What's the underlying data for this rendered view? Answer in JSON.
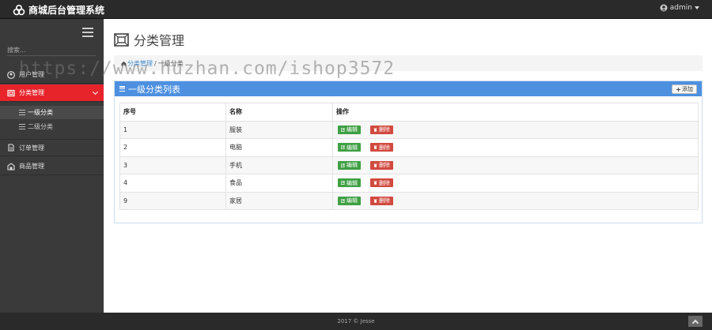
{
  "app": {
    "title": "商城后台管理系统",
    "user": "admin"
  },
  "sidebar": {
    "search_placeholder": "搜索...",
    "items": [
      {
        "label": "用户管理",
        "icon": "user-icon"
      },
      {
        "label": "分类管理",
        "icon": "category-icon",
        "active": true,
        "children": [
          {
            "label": "一级分类",
            "current": true
          },
          {
            "label": "二级分类"
          }
        ]
      },
      {
        "label": "订单管理",
        "icon": "order-icon"
      },
      {
        "label": "商品管理",
        "icon": "product-icon"
      }
    ]
  },
  "main": {
    "page_title": "分类管理",
    "breadcrumb": {
      "parent": "分类管理",
      "separator": "/",
      "current": "一级分类"
    },
    "panel": {
      "title": "一级分类列表",
      "add_label": "添加",
      "columns": [
        "序号",
        "名称",
        "操作"
      ],
      "edit_label": "编辑",
      "delete_label": "删除",
      "rows": [
        {
          "id": "1",
          "name": "服装"
        },
        {
          "id": "2",
          "name": "电脑"
        },
        {
          "id": "3",
          "name": "手机"
        },
        {
          "id": "4",
          "name": "食品"
        },
        {
          "id": "9",
          "name": "家居"
        }
      ]
    }
  },
  "footer": {
    "text": "2017 © Jesse"
  },
  "watermark": "https://www.huzhan.com/ishop3572",
  "colors": {
    "active_red": "#e8242b",
    "panel_blue": "#4d90e0",
    "edit_green": "#3fa044",
    "delete_red": "#d14a3f"
  }
}
